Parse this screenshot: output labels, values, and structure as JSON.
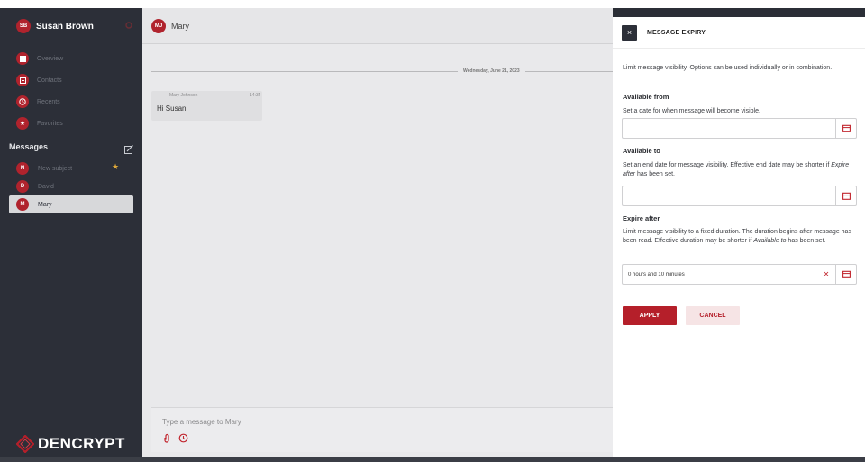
{
  "sidebar": {
    "user": {
      "initials": "SB",
      "name": "Susan Brown"
    },
    "nav": [
      {
        "label": "Overview",
        "icon": "grid-icon"
      },
      {
        "label": "Contacts",
        "icon": "contacts-icon"
      },
      {
        "label": "Recents",
        "icon": "clock-icon"
      },
      {
        "label": "Favorites",
        "icon": "star-icon"
      }
    ],
    "messages_title": "Messages",
    "conversations": [
      {
        "initials": "N",
        "label": "New subject",
        "starred": true
      },
      {
        "initials": "D",
        "label": "David",
        "starred": false
      },
      {
        "initials": "M",
        "label": "Mary",
        "starred": false,
        "active": true
      }
    ],
    "logo_text": "DENCRYPT"
  },
  "chat": {
    "avatar_initials": "MJ",
    "title": "Mary",
    "date_separator": "Wednesday, June 21, 2023",
    "message": {
      "sender": "Mary Johnson",
      "time": "14:34",
      "text": "Hi Susan"
    },
    "composer_placeholder": "Type a message to Mary"
  },
  "panel": {
    "close_label": "×",
    "title": "MESSAGE EXPIRY",
    "intro": "Limit message visibility. Options can be used individually or in combination.",
    "available_from": {
      "heading": "Available from",
      "description": "Set a date for when message will become visible.",
      "value": ""
    },
    "available_to": {
      "heading": "Available to",
      "description_pre": "Set an end date for message visibility. Effective end date may be shorter if ",
      "description_em": "Expire after",
      "description_post": " has been set.",
      "value": ""
    },
    "expire_after": {
      "heading": "Expire after",
      "description_pre": "Limit message visibility to a fixed duration. The duration begins after message has been read. Effective duration may be shorter if ",
      "description_em": "Available to",
      "description_post": " has been set.",
      "value": "0 hours and 10 minutes"
    },
    "apply_label": "APPLY",
    "cancel_label": "CANCEL"
  },
  "colors": {
    "brand_red": "#b51f2a",
    "sidebar_bg": "#2c2f38",
    "star": "#e0a93a"
  }
}
